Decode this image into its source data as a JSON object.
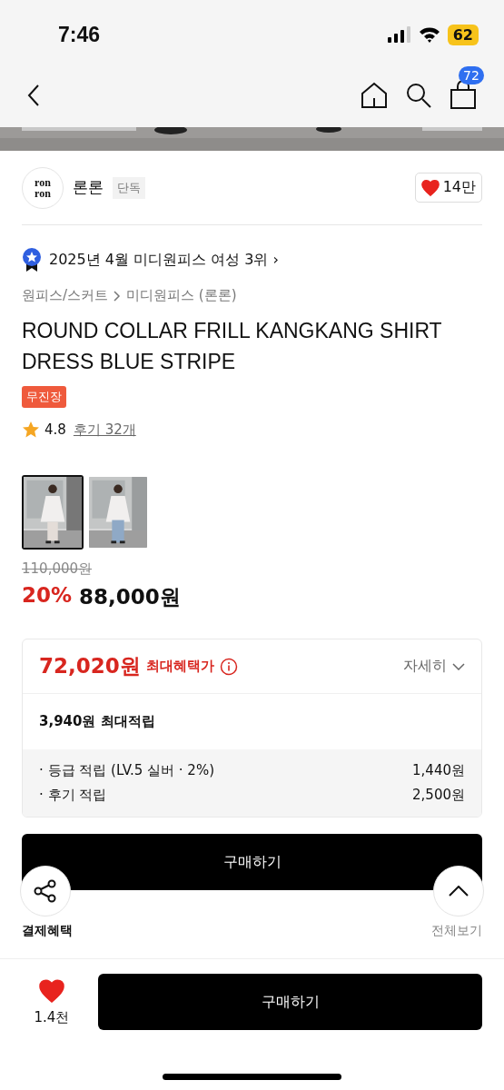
{
  "status_bar": {
    "time": "7:46",
    "battery": "62"
  },
  "nav": {
    "cart_count": "72"
  },
  "seller": {
    "logo": "ron ron",
    "name": "론론",
    "tag": "단독",
    "likes": "14만",
    "liked": true
  },
  "ranking": {
    "text": "2025년 4월 미디원피스 여성 3위",
    "chevron": "›"
  },
  "breadcrumb": [
    {
      "label": "원피스/스커트"
    },
    {
      "label": "미디원피스 (론론)"
    }
  ],
  "title": "ROUND COLLAR FRILL KANGKANG SHIRT DRESS BLUE STRIPE",
  "badge": "무진장",
  "rating": {
    "score": "4.8",
    "reviews": "후기 32개"
  },
  "thumbnails": [
    {
      "kind": "picture",
      "selected": true
    },
    {
      "kind": "picture",
      "selected": false
    }
  ],
  "price": {
    "original": "110,000원",
    "discount": "20%",
    "sale": "88,000원"
  },
  "benefit": {
    "price": "72,020원",
    "label": "최대혜택가",
    "more": "자세히",
    "points": "3,940원 최대적립",
    "rows": [
      {
        "label": "· 등급 적립 (LV.5 실버 · 2%)",
        "value": "1,440원"
      },
      {
        "label": "· 후기 적립",
        "value": "2,500원"
      }
    ]
  },
  "buy_button": "구매하기",
  "payment": {
    "title": "결제혜택",
    "view_all": "전체보기"
  },
  "bottom_bar": {
    "liked": true,
    "likes": "1.4천",
    "buy": "구매하기"
  }
}
